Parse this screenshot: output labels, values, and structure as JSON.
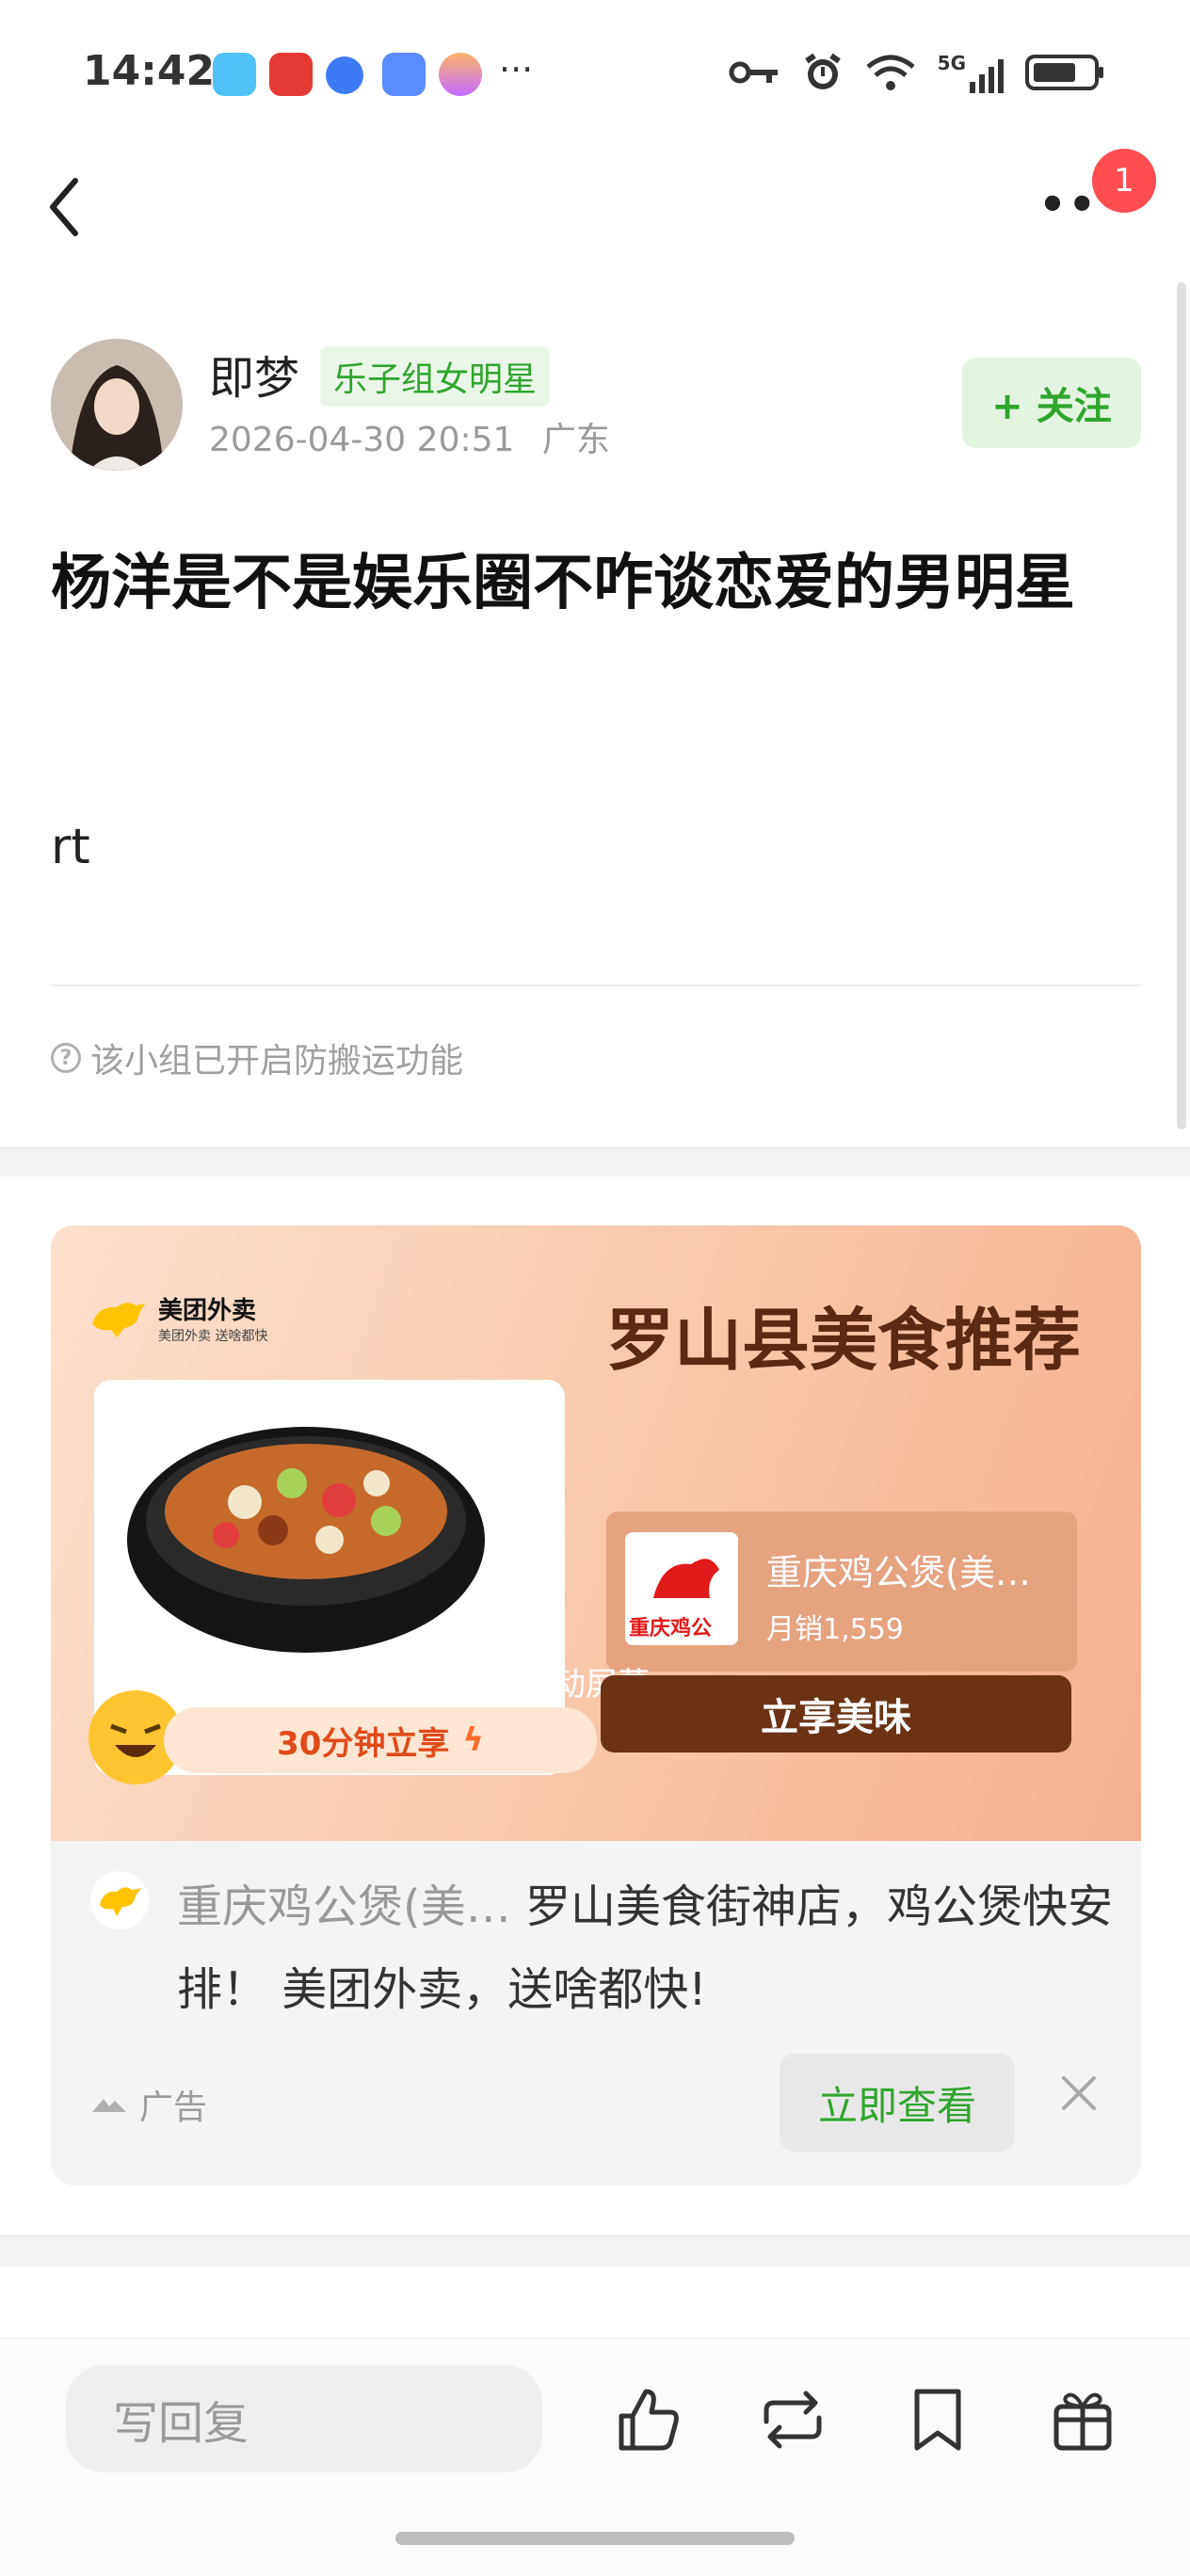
{
  "status_bar": {
    "time": "14:42",
    "more_dots": "···",
    "network": "5G",
    "app_icons": [
      "book-app-icon",
      "red-app-icon",
      "blue-app-icon",
      "chat-app-icon",
      "pink-app-icon"
    ]
  },
  "nav": {
    "more": "••",
    "notification_count": "1"
  },
  "post": {
    "author": "即梦",
    "badge": "乐子组女明星",
    "datetime": "2026-04-30 20:51",
    "location": "广东",
    "follow_label": "+ 关注",
    "title": "杨洋是不是娱乐圈不咋谈恋爱的男明星",
    "body": "rt",
    "notice": "该小组已开启防搬运功能"
  },
  "ad": {
    "brand_logo_name": "美团外卖",
    "brand_logo_sub": "美团外卖 送啥都快",
    "headline": "罗山县美食推荐",
    "pill": "30分钟立享",
    "shop_name": "重庆鸡公煲(美…",
    "shop_sales": "月销1,559",
    "shop_thumb_text": "重庆鸡公",
    "shop_button": "立享美味",
    "overlay_text": "动屏幕",
    "desc_brand": "重庆鸡公煲(美…",
    "desc_text": " 罗山美食街神店，鸡公煲快安排！ 美团外卖，送啥都快!",
    "label": "广告",
    "cta": "立即查看",
    "colors": {
      "banner_start": "#fde0cc",
      "banner_end": "#f5b08e",
      "button": "#6b3313"
    }
  },
  "bottom_bar": {
    "reply_placeholder": "写回复",
    "icons": [
      "like-icon",
      "repost-icon",
      "bookmark-icon",
      "gift-icon"
    ]
  },
  "colors": {
    "accent_green": "#2fa52d",
    "badge_red": "#ff4d52"
  }
}
